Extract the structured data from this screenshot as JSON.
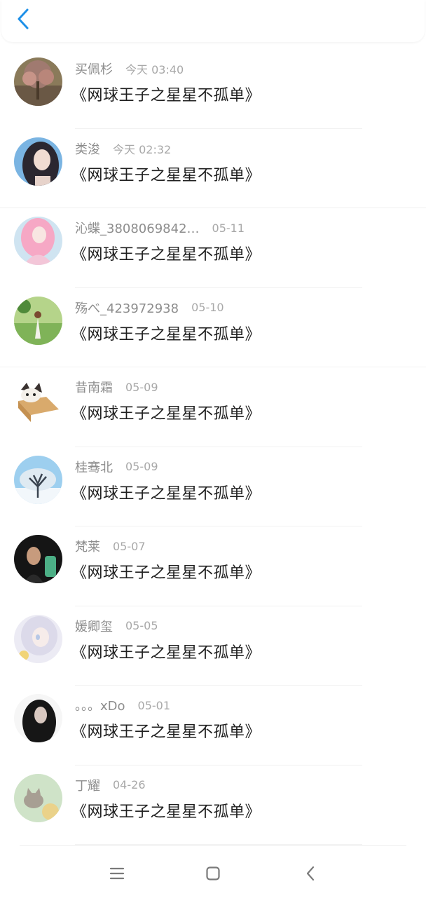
{
  "comments": [
    {
      "username": "买佩杉",
      "time": "今天 03:40",
      "text": "《网球王子之星星不孤单》",
      "avatar": "tree-avatar-icon",
      "avatar_colors": [
        "#6a5845",
        "#c79488",
        "#8a7a5a"
      ]
    },
    {
      "username": "类浚",
      "time": "今天 02:32",
      "text": "《网球王子之星星不孤单》",
      "avatar": "girl-avatar-icon",
      "avatar_colors": [
        "#7ab4e2",
        "#2b2730",
        "#f1dcd2"
      ]
    },
    {
      "username": "沁蝶_3808069842…",
      "time": "05-11",
      "text": "《网球王子之星星不孤单》",
      "avatar": "anime-girl-avatar-icon",
      "avatar_colors": [
        "#f3c6d8",
        "#cfe4f1",
        "#f6a8c5"
      ]
    },
    {
      "username": "殇べ_423972938",
      "time": "05-10",
      "text": "《网球王子之星星不孤单》",
      "avatar": "meadow-girl-avatar-icon",
      "avatar_colors": [
        "#7fb358",
        "#b5d48a",
        "#f2f2ea"
      ]
    },
    {
      "username": "昔南霜",
      "time": "05-09",
      "text": "《网球王子之星星不孤单》",
      "avatar": "cat-in-box-avatar-icon",
      "avatar_colors": [
        "#ffffff",
        "#d9aa6c",
        "#3a3230"
      ]
    },
    {
      "username": "桂骞北",
      "time": "05-09",
      "text": "《网球王子之星星不孤单》",
      "avatar": "snow-tree-avatar-icon",
      "avatar_colors": [
        "#9dcfef",
        "#f2f7fb",
        "#3a4450"
      ]
    },
    {
      "username": "梵莱",
      "time": "05-07",
      "text": "《网球王子之星星不孤单》",
      "avatar": "dark-portrait-avatar-icon",
      "avatar_colors": [
        "#151515",
        "#c79b7d",
        "#4caf86"
      ]
    },
    {
      "username": "媛卿玺",
      "time": "05-05",
      "text": "《网球王子之星星不孤单》",
      "avatar": "white-hair-anime-avatar-icon",
      "avatar_colors": [
        "#ecebf4",
        "#b7c8e6",
        "#f1d478"
      ]
    },
    {
      "username": "。。。xDo",
      "time": "05-01",
      "text": "《网球王子之星星不孤单》",
      "avatar": "black-hair-girl-avatar-icon",
      "avatar_colors": [
        "#f6f6f6",
        "#161616",
        "#d8c8c0"
      ]
    },
    {
      "username": "丁耀",
      "time": "04-26",
      "text": "《网球王子之星星不孤单》",
      "avatar": "cat-watercolor-avatar-icon",
      "avatar_colors": [
        "#cfe3c8",
        "#a79f93",
        "#ead28a"
      ]
    }
  ],
  "header": {
    "back_icon": "chevron-left-icon",
    "accent": "#1e90e8"
  },
  "nav": {
    "menu_icon": "menu-icon",
    "home_icon": "home-square-icon",
    "back_icon": "back-triangle-icon",
    "color": "#7a7a7a"
  }
}
